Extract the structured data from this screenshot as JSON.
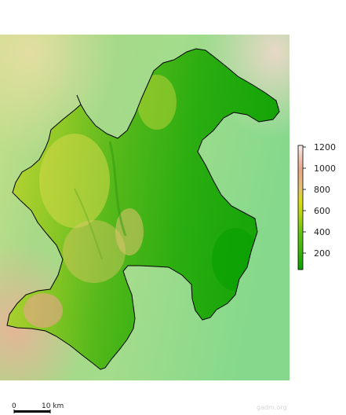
{
  "legend": {
    "labels": [
      "1200",
      "1000",
      "800",
      "600",
      "400",
      "200"
    ],
    "unit_description": "",
    "colors": [
      "#fbeff0",
      "#e7a789",
      "#e3c271",
      "#d9dd14",
      "#65c410",
      "#06a000"
    ]
  },
  "scalebar": {
    "start_label": "0",
    "end_label": "10 km"
  },
  "credit": "gadm.org"
}
